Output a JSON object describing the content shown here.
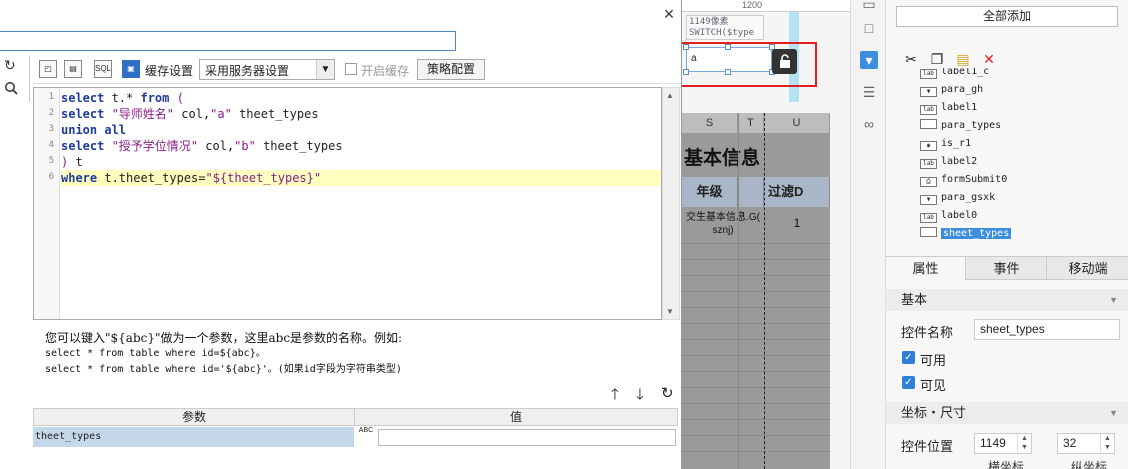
{
  "designer": {
    "ruler_mark": "1200",
    "widget_label_lines": [
      "1149像素",
      "SWITCH($type"
    ],
    "widget_input_value": "a",
    "lock_icon": "lock-icon",
    "columns": [
      "S",
      "T",
      "U"
    ],
    "title_text": "基本信息",
    "header_cells": [
      "年级",
      "过滤D"
    ],
    "data_cell_text": "交生基本信息.G( sznj)",
    "data_cell_value": "1"
  },
  "dialog": {
    "close_label": "×",
    "toolbar": {
      "cache_label": "缓存设置",
      "server_select": "采用服务器设置",
      "enable_cache_label": "开启缓存",
      "strategy_button": "策略配置"
    },
    "code_lines": [
      {
        "n": "1",
        "parts": [
          {
            "c": "kw",
            "t": "select"
          },
          {
            "c": "pl",
            "t": " t.* "
          },
          {
            "c": "kw",
            "t": "from"
          },
          {
            "c": "str",
            "t": " ("
          }
        ]
      },
      {
        "n": "2",
        "parts": [
          {
            "c": "kw",
            "t": "select"
          },
          {
            "c": "str",
            "t": " \"导师姓名\""
          },
          {
            "c": "pl",
            "t": " col,"
          },
          {
            "c": "str",
            "t": "\"a\""
          },
          {
            "c": "pl",
            "t": " theet_types"
          }
        ]
      },
      {
        "n": "3",
        "parts": [
          {
            "c": "kw",
            "t": "union all"
          }
        ]
      },
      {
        "n": "4",
        "parts": [
          {
            "c": "kw",
            "t": "select"
          },
          {
            "c": "str",
            "t": " \"授予学位情况\""
          },
          {
            "c": "pl",
            "t": " col,"
          },
          {
            "c": "str",
            "t": "\"b\""
          },
          {
            "c": "pl",
            "t": " theet_types"
          }
        ]
      },
      {
        "n": "5",
        "parts": [
          {
            "c": "str",
            "t": ")"
          },
          {
            "c": "pl",
            "t": " t"
          }
        ]
      },
      {
        "n": "6",
        "parts": [
          {
            "c": "kw",
            "t": "where"
          },
          {
            "c": "pl",
            "t": " t.theet_types="
          },
          {
            "c": "str",
            "t": "\"${theet_types}\""
          }
        ]
      }
    ],
    "hint_line1": "您可以键入\"${abc}\"做为一个参数，这里abc是参数的名称。例如:",
    "hint_line2": "select * from table where id=${abc}。",
    "hint_line3": "select * from table where id='${abc}'。(如果id字段为字符串类型)",
    "param_table": {
      "col_param": "参数",
      "col_value": "值",
      "rows": [
        {
          "name": "theet_types",
          "type_icon": "ABC",
          "value": ""
        }
      ]
    }
  },
  "right_panel": {
    "add_all": "全部添加",
    "tree_items": [
      {
        "label": "label1_c",
        "icon": "lab"
      },
      {
        "label": "para_gh",
        "icon": "dropdown"
      },
      {
        "label": "label1",
        "icon": "lab"
      },
      {
        "label": "para_types",
        "icon": "textbox"
      },
      {
        "label": "is_r1",
        "icon": "radio"
      },
      {
        "label": "label2",
        "icon": "lab"
      },
      {
        "label": "formSubmit0",
        "icon": "submit"
      },
      {
        "label": "para_gsxk",
        "icon": "dropdown"
      },
      {
        "label": "label0",
        "icon": "lab"
      },
      {
        "label": "sheet_types",
        "icon": "textbox"
      }
    ],
    "tabs": [
      "属性",
      "事件",
      "移动端"
    ],
    "section_basic": "基本",
    "control_name_label": "控件名称",
    "control_name_value": "sheet_types",
    "enabled_label": "可用",
    "visible_label": "可见",
    "section_geometry": "坐标・尺寸",
    "position_label": "控件位置",
    "pos_x": "1149",
    "pos_y": "32",
    "x_label": "横坐标",
    "y_label": "纵坐标"
  }
}
